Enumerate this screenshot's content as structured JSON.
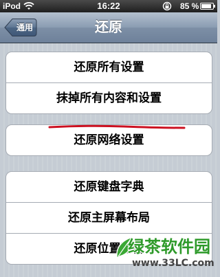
{
  "status_bar": {
    "carrier": "iPod",
    "time": "16:22",
    "battery_percent": "85 %",
    "battery_level": 0.85
  },
  "navbar": {
    "back_label": "通用",
    "title": "还原"
  },
  "groups": [
    {
      "items": [
        "还原所有设置",
        "抹掉所有内容和设置"
      ]
    },
    {
      "items": [
        "还原网络设置"
      ]
    },
    {
      "items": [
        "还原键盘字典",
        "还原主屏幕布局",
        "还原位置警告"
      ]
    }
  ],
  "watermark": {
    "brand": "绿茶软件园",
    "url": "www.33LC.com"
  },
  "colors": {
    "annotation_line": "#cc1020",
    "watermark_green": "#2e9a2a"
  }
}
